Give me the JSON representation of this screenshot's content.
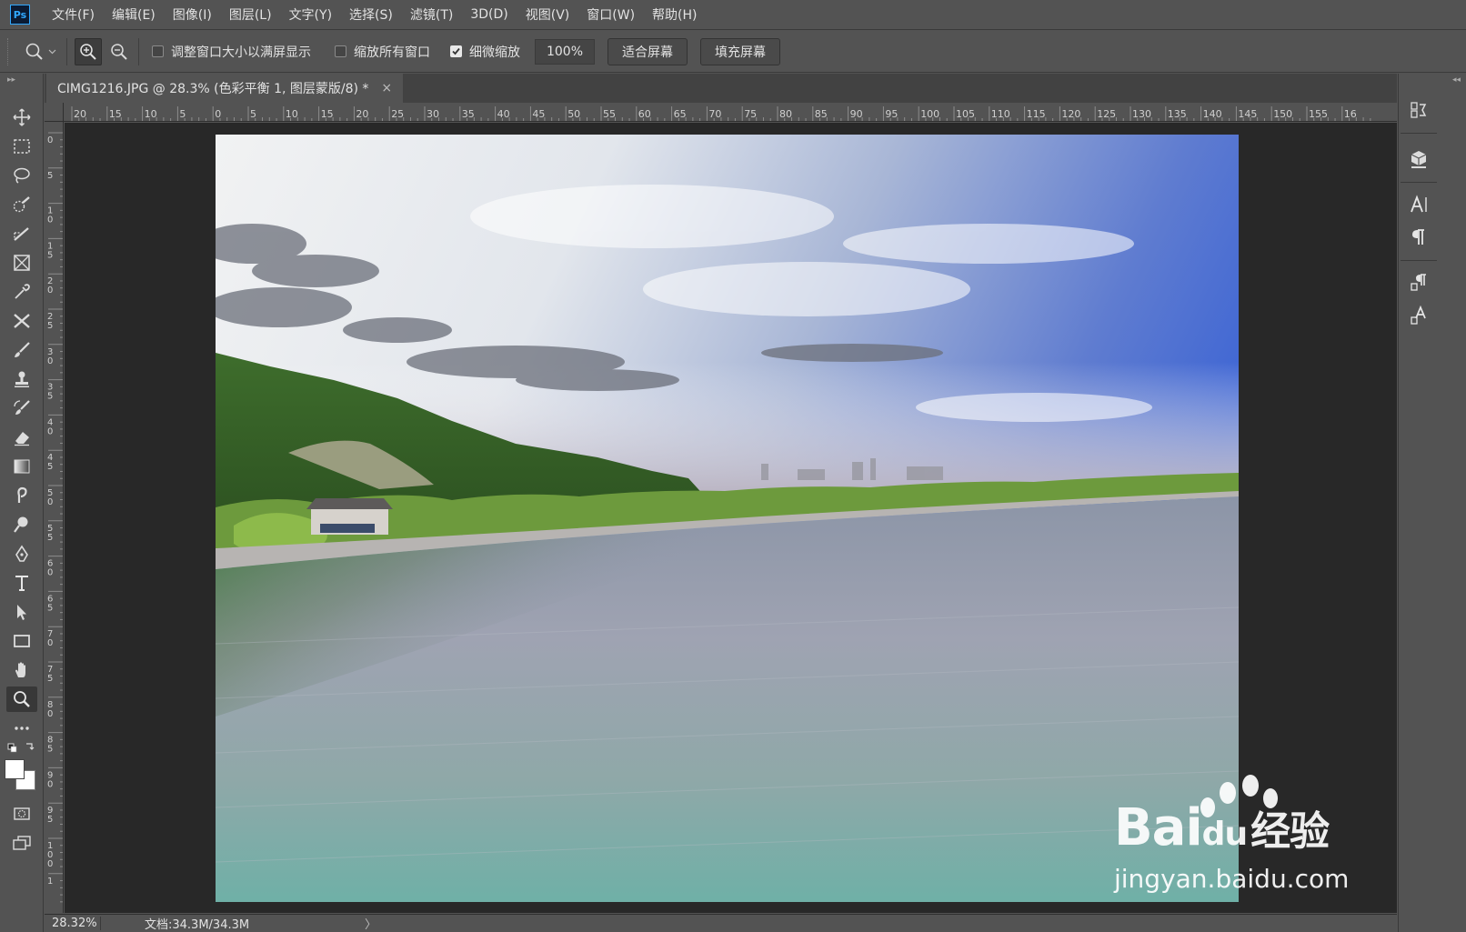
{
  "app": {
    "logo": "Ps"
  },
  "menu": [
    "文件(F)",
    "编辑(E)",
    "图像(I)",
    "图层(L)",
    "文字(Y)",
    "选择(S)",
    "滤镜(T)",
    "3D(D)",
    "视图(V)",
    "窗口(W)",
    "帮助(H)"
  ],
  "options": {
    "resize_windows_label": "调整窗口大小以满屏显示",
    "resize_windows_checked": false,
    "zoom_all_label": "缩放所有窗口",
    "zoom_all_checked": false,
    "scrubby_zoom_label": "细微缩放",
    "scrubby_zoom_checked": true,
    "zoom_value": "100%",
    "fit_screen_label": "适合屏幕",
    "fill_screen_label": "填充屏幕"
  },
  "document": {
    "tab_title": "CIMG1216.JPG @ 28.3% (色彩平衡 1, 图层蒙版/8) *",
    "close_glyph": "×"
  },
  "rulers": {
    "top": [
      "20",
      "15",
      "10",
      "5",
      "0",
      "5",
      "10",
      "15",
      "20",
      "25",
      "30",
      "35",
      "40",
      "45",
      "50",
      "55",
      "60",
      "65",
      "70",
      "75",
      "80",
      "85",
      "90",
      "95",
      "100",
      "105",
      "110",
      "115",
      "120",
      "125",
      "130",
      "135",
      "140",
      "145",
      "150",
      "155",
      "16"
    ],
    "left": [
      "0",
      "5",
      "1 0",
      "1 5",
      "2 0",
      "2 5",
      "3 0",
      "3 5",
      "4 0",
      "4 5",
      "5 0",
      "5 5",
      "6 0",
      "6 5",
      "7 0",
      "7 5",
      "8 0",
      "8 5",
      "9 0",
      "9 5",
      "1 0 0",
      "1"
    ]
  },
  "tools": [
    "move-tool",
    "marquee-tool",
    "lasso-tool",
    "quick-selection-tool",
    "object-selection-tool",
    "frame-tool",
    "eyedropper-tool",
    "healing-brush-tool",
    "brush-tool",
    "clone-stamp-tool",
    "history-brush-tool",
    "eraser-tool",
    "gradient-tool",
    "smudge-tool",
    "dodge-tool",
    "pen-tool",
    "type-tool",
    "path-selection-tool",
    "rectangle-tool",
    "hand-tool",
    "zoom-tool",
    "edit-toolbar"
  ],
  "status": {
    "zoom": "28.32%",
    "doc_info": "文档:34.3M/34.3M",
    "arrow": "〉"
  },
  "watermark": {
    "brand": "Bai",
    "brand_tail": "du",
    "cn": "经验",
    "url": "jingyan.baidu.com"
  }
}
